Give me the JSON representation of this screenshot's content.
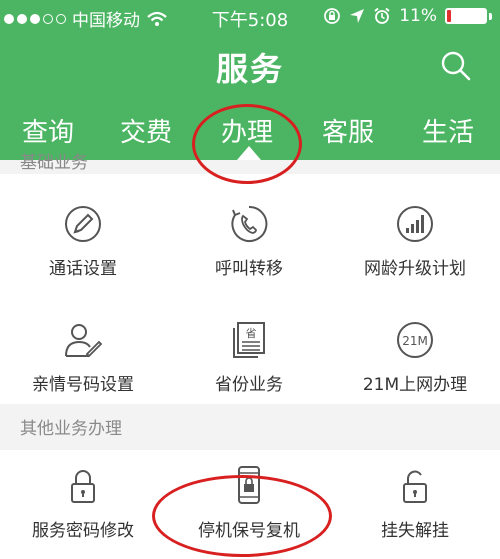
{
  "status_bar": {
    "carrier": "中国移动",
    "time": "下午5:08",
    "battery_text": "11%",
    "battery_level": 0.11,
    "signal_bars": 3,
    "signal_max": 5,
    "icons": [
      "signal-icon",
      "wifi-icon",
      "rotation-lock-icon",
      "location-icon",
      "alarm-icon",
      "battery-icon"
    ]
  },
  "header": {
    "title": "服务",
    "search_icon": "search-icon"
  },
  "tabs": [
    {
      "label": "查询"
    },
    {
      "label": "交费"
    },
    {
      "label": "办理",
      "selected": true
    },
    {
      "label": "客服"
    },
    {
      "label": "生活"
    }
  ],
  "partial_section": "基础业务",
  "basic_items": [
    {
      "label": "通话设置",
      "icon": "pencil-icon"
    },
    {
      "label": "呼叫转移",
      "icon": "call-forward-icon"
    },
    {
      "label": "网龄升级计划",
      "icon": "upgrade-bars-icon"
    },
    {
      "label": "亲情号码设置",
      "icon": "family-contact-icon"
    },
    {
      "label": "省份业务",
      "icon": "province-document-icon"
    },
    {
      "label": "21M上网办理",
      "icon": "data-21m-icon",
      "icon_text": "21M"
    }
  ],
  "other_section": "其他业务办理",
  "province_icon_text": "省",
  "other_items": [
    {
      "label": "服务密码修改",
      "icon": "lock-icon"
    },
    {
      "label": "停机保号复机",
      "icon": "phone-lock-icon"
    },
    {
      "label": "挂失解挂",
      "icon": "unlock-icon"
    }
  ],
  "colors": {
    "brand_green": "#4cb563",
    "annotation_red": "#d82020",
    "battery_red": "#e03030"
  }
}
